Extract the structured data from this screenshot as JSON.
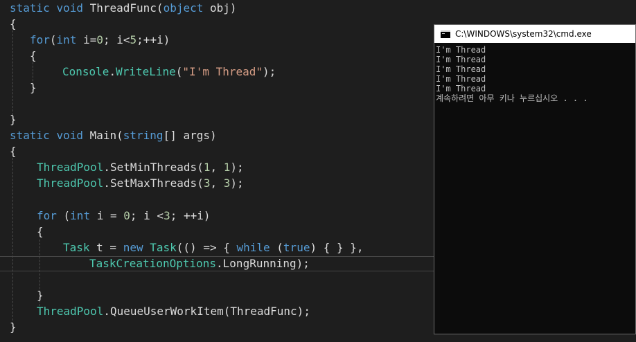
{
  "editor": {
    "lines": [
      {
        "indent": "",
        "tokens": [
          [
            "kw",
            "static"
          ],
          [
            "pl",
            " "
          ],
          [
            "kw",
            "void"
          ],
          [
            "pl",
            " ThreadFunc("
          ],
          [
            "kw",
            "object"
          ],
          [
            "pl",
            " obj)"
          ]
        ]
      },
      {
        "indent": "",
        "tokens": [
          [
            "pl",
            "{"
          ]
        ]
      },
      {
        "indent": "    ",
        "tokens": [
          [
            "kw",
            "for"
          ],
          [
            "pl",
            "("
          ],
          [
            "kw",
            "int"
          ],
          [
            "pl",
            " i="
          ],
          [
            "nm",
            "0"
          ],
          [
            "pl",
            "; i<"
          ],
          [
            "nm",
            "5"
          ],
          [
            "pl",
            ";++i)"
          ]
        ]
      },
      {
        "indent": "    ",
        "tokens": [
          [
            "pl",
            "{"
          ]
        ]
      },
      {
        "indent": "        ",
        "tokens": [
          [
            "ty",
            "Console"
          ],
          [
            "pl",
            "."
          ],
          [
            "ty",
            "WriteLine"
          ],
          [
            "pl",
            "("
          ],
          [
            "st",
            "\"I'm Thread\""
          ],
          [
            "pl",
            ");"
          ]
        ]
      },
      {
        "indent": "    ",
        "tokens": [
          [
            "pl",
            "}"
          ]
        ]
      },
      {
        "indent": "",
        "tokens": []
      },
      {
        "indent": "",
        "tokens": [
          [
            "pl",
            "}"
          ]
        ]
      },
      {
        "indent": "",
        "tokens": [
          [
            "kw",
            "static"
          ],
          [
            "pl",
            " "
          ],
          [
            "kw",
            "void"
          ],
          [
            "pl",
            " Main("
          ],
          [
            "kw",
            "string"
          ],
          [
            "pl",
            "[] args)"
          ]
        ]
      },
      {
        "indent": "",
        "tokens": [
          [
            "pl",
            "{"
          ]
        ]
      },
      {
        "indent": "    ",
        "tokens": [
          [
            "ty",
            "ThreadPool"
          ],
          [
            "pl",
            ".SetMinThreads("
          ],
          [
            "nm",
            "1"
          ],
          [
            "pl",
            ", "
          ],
          [
            "nm",
            "1"
          ],
          [
            "pl",
            ");"
          ]
        ]
      },
      {
        "indent": "    ",
        "tokens": [
          [
            "ty",
            "ThreadPool"
          ],
          [
            "pl",
            ".SetMaxThreads("
          ],
          [
            "nm",
            "3"
          ],
          [
            "pl",
            ", "
          ],
          [
            "nm",
            "3"
          ],
          [
            "pl",
            ");"
          ]
        ]
      },
      {
        "indent": "",
        "tokens": []
      },
      {
        "indent": "    ",
        "tokens": [
          [
            "kw",
            "for"
          ],
          [
            "pl",
            " ("
          ],
          [
            "kw",
            "int"
          ],
          [
            "pl",
            " i = "
          ],
          [
            "nm",
            "0"
          ],
          [
            "pl",
            "; i <"
          ],
          [
            "nm",
            "3"
          ],
          [
            "pl",
            "; ++i)"
          ]
        ]
      },
      {
        "indent": "    ",
        "tokens": [
          [
            "pl",
            "{"
          ]
        ]
      },
      {
        "indent": "        ",
        "tokens": [
          [
            "ty",
            "Task"
          ],
          [
            "pl",
            " t = "
          ],
          [
            "kw",
            "new"
          ],
          [
            "pl",
            " "
          ],
          [
            "ty",
            "Task"
          ],
          [
            "pl",
            "(() => { "
          ],
          [
            "kw",
            "while"
          ],
          [
            "pl",
            " ("
          ],
          [
            "kw",
            "true"
          ],
          [
            "pl",
            ") { } },"
          ]
        ]
      },
      {
        "indent": "            ",
        "tokens": [
          [
            "ty",
            "TaskCreationOptions"
          ],
          [
            "pl",
            ".LongRunning);"
          ]
        ]
      },
      {
        "indent": "",
        "tokens": []
      },
      {
        "indent": "    ",
        "tokens": [
          [
            "pl",
            "}"
          ]
        ]
      },
      {
        "indent": "    ",
        "tokens": [
          [
            "ty",
            "ThreadPool"
          ],
          [
            "pl",
            ".QueueUserWorkItem(ThreadFunc);"
          ]
        ]
      },
      {
        "indent": "",
        "tokens": [
          [
            "pl",
            "}"
          ]
        ]
      }
    ]
  },
  "console": {
    "title": "C:\\WINDOWS\\system32\\cmd.exe",
    "icon": "cmd-icon",
    "output": [
      "I'm Thread",
      "I'm Thread",
      "I'm Thread",
      "I'm Thread",
      "I'm Thread",
      "계속하려면 아무 키나 누르십시오 . . ."
    ]
  },
  "colors": {
    "background": "#1e1e1e",
    "keyword": "#569cd6",
    "type": "#4ec9b0",
    "string": "#d69d85",
    "number": "#b5cea8",
    "plain": "#dcdcdc",
    "console_background": "#0c0c0c",
    "console_text": "#c0c0c0"
  }
}
